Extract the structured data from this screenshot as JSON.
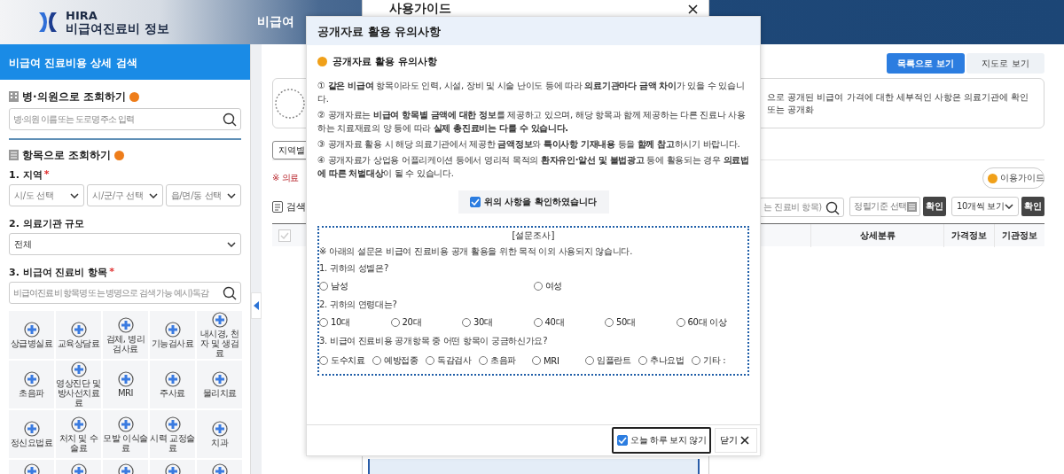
{
  "header": {
    "logo_line1": "HIRA",
    "logo_line2": "비급여진료비 정보",
    "nav_title": "비급여"
  },
  "sidebar": {
    "title": "비급여 진료비용 상세 검색",
    "hospital_search": {
      "heading": "병·의원으로 조회하기",
      "placeholder": "병·의원 이름 또는 도로명 주소 입력"
    },
    "item_search": {
      "heading": "항목으로 조회하기",
      "region": {
        "label": "1. 지역",
        "required_mark": "*",
        "selects": [
          {
            "placeholder": "시/도 선택"
          },
          {
            "placeholder": "시/군/구 선택"
          },
          {
            "placeholder": "읍/면/동 선택"
          }
        ]
      },
      "scale": {
        "label": "2. 의료기관 규모",
        "value": "전체"
      },
      "items": {
        "label": "3. 비급여 진료비 항목",
        "required_mark": "*",
        "placeholder": "비급여진료비 항목명 또는 병명으로 검색 가능 예시)독감",
        "categories": [
          {
            "kind": "labeled",
            "label": "상급병실료"
          },
          {
            "kind": "labeled",
            "label": "교육상담료"
          },
          {
            "kind": "labeled",
            "label": "검체, 병리 검사료"
          },
          {
            "kind": "labeled",
            "label": "기능검사료"
          },
          {
            "kind": "labeled",
            "label": "내시경, 천자 및 생검료"
          },
          {
            "kind": "labeled",
            "label": "초음파"
          },
          {
            "kind": "labeled",
            "label": "영상진단 및 방사선치료료"
          },
          {
            "kind": "labeled",
            "label": "MRI"
          },
          {
            "kind": "labeled",
            "label": "주사료"
          },
          {
            "kind": "labeled",
            "label": "물리치료"
          },
          {
            "kind": "labeled",
            "label": "정신요법료"
          },
          {
            "kind": "labeled",
            "label": "처치 및 수술료"
          },
          {
            "kind": "labeled",
            "label": "모발 이식술료"
          },
          {
            "kind": "labeled",
            "label": "시력 교정술료"
          },
          {
            "kind": "labeled",
            "label": "치과"
          },
          {
            "kind": "icon_only"
          },
          {
            "kind": "icon_only"
          },
          {
            "kind": "icon_only"
          },
          {
            "kind": "icon_only"
          },
          {
            "kind": "icon_only"
          }
        ]
      }
    }
  },
  "content": {
    "view_tabs": [
      {
        "label": "목록으로 보기",
        "selected": true
      },
      {
        "label": "지도로 보기",
        "selected": false
      }
    ],
    "info_text": "으로 공개된 비급여 가격에 대한 세부적인 사항은 의료기관에 확인 또는 공개화",
    "region_select": "지역별",
    "notice": "※ 의료",
    "guide_button": "이용가이드",
    "results_label": "검색",
    "toolbar": {
      "search_placeholder": "는 진료비 항목)",
      "sort_placeholder": "정렬기준 선택",
      "sort_button": "확인",
      "page_size": "10개씩 보기",
      "page_size_button": "확인"
    },
    "table": {
      "select_all": {
        "checked": false
      },
      "columns": [
        {
          "label": "상세분류"
        },
        {
          "label": "가격정보"
        },
        {
          "label": "기관정보"
        }
      ]
    }
  },
  "guide_panel": {
    "title": "사용가이드"
  },
  "modal": {
    "title": "공개자료 활용 유의사항",
    "heading": "공개자료 활용 유의사항",
    "notes": [
      "① **같은 비급여** 항목이라도 인력, 시설, 장비 및 시술 난이도 등에 따라 **의료기관마다 금액 차이**가 있을 수 있습니다.",
      "② 공개자료는 **비급여 항목별 금액에 대한 정보**를 제공하고 있으며, 해당 항목과 함께 제공하는 다른 진료나 사용하는 치료재료의 양 등에 따라 **실제 총진료비는 다를 수 있습니다.**",
      "③ 공개자료 활용 시 해당 의료기관에서 제공한 **금액정보**와 **특이사항 기재내용** 등을 **함께 참고**하시기 바랍니다.",
      "④ 공개자료가 상업용 어플리케이션 등에서 영리적 목적의 **환자유인·알선 및 불법광고** 등에 활용되는 경우 **의료법에 따른 처벌대상**이 될 수 있습니다."
    ],
    "confirm": {
      "label": "위의 사항을 확인하였습니다",
      "checked": true
    },
    "survey": {
      "title": "[설문조사]",
      "notice": "※ 아래의 설문은 비급여 진료비용 공개 활용을 위한 목적 이외 사용되지 않습니다.",
      "questions": [
        {
          "text": "1. 귀하의 성별은?",
          "options": [
            {
              "label": "남성",
              "selected": false
            },
            {
              "label": "여성",
              "selected": false
            }
          ]
        },
        {
          "text": "2. 귀하의 연령대는?",
          "options": [
            {
              "label": "10대",
              "selected": false
            },
            {
              "label": "20대",
              "selected": false
            },
            {
              "label": "30대",
              "selected": false
            },
            {
              "label": "40대",
              "selected": false
            },
            {
              "label": "50대",
              "selected": false
            },
            {
              "label": "60대 이상",
              "selected": false
            }
          ]
        },
        {
          "text": "3. 비급여 진료비용 공개항목 중 어떤 항목이 궁금하신가요?",
          "options": [
            {
              "label": "도수치료",
              "selected": false
            },
            {
              "label": "예방접종",
              "selected": false
            },
            {
              "label": "독감검사",
              "selected": false
            },
            {
              "label": "초음파",
              "selected": false
            },
            {
              "label": "MRI",
              "selected": false
            },
            {
              "label": "임플란트",
              "selected": false
            },
            {
              "label": "추나요법",
              "selected": false
            },
            {
              "label": "기타 :",
              "selected": false
            }
          ]
        }
      ]
    },
    "dismiss_today": {
      "label": "오늘 하루 보지 않기",
      "checked": true
    },
    "close_label": "닫기"
  }
}
